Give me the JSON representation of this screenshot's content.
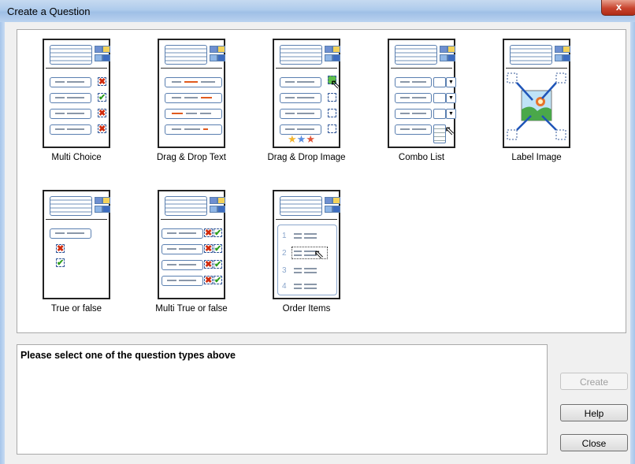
{
  "window": {
    "title": "Create a Question",
    "close_glyph": "x"
  },
  "question_types": [
    {
      "label": "Multi Choice"
    },
    {
      "label": "Drag & Drop Text"
    },
    {
      "label": "Drag & Drop Image"
    },
    {
      "label": "Combo List"
    },
    {
      "label": "Label Image"
    },
    {
      "label": "True or false"
    },
    {
      "label": "Multi True or false"
    },
    {
      "label": "Order Items"
    }
  ],
  "description": {
    "text": "Please select one of the question types above"
  },
  "buttons": {
    "create": "Create",
    "help": "Help",
    "close": "Close"
  },
  "order_items_numbers": [
    "1",
    "2",
    "3",
    "4"
  ],
  "colors": {
    "accent_blue": "#5a7fb0",
    "cross_red": "#d12c0e",
    "check_green": "#2c9c1c",
    "titlebar": "#aecbec"
  }
}
